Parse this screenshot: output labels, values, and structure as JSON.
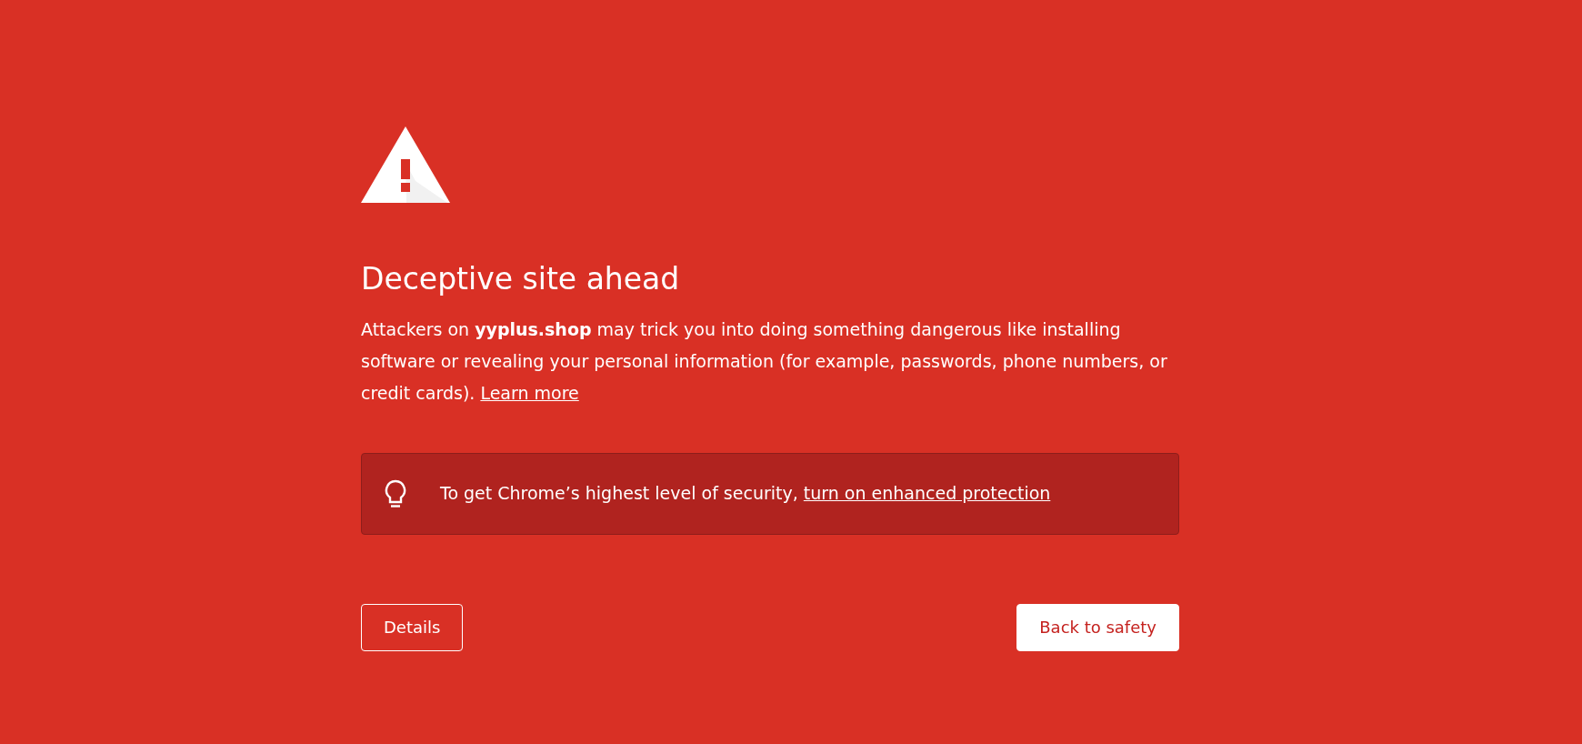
{
  "heading": "Deceptive site ahead",
  "message": "Attackers on **yyplus.shop** may trick you into doing something dangerous like installing software or revealing your personal information (for example, passwords, phone numbers, or credit cards).",
  "learn_more": "Learn more",
  "enhanced": {
    "text": "To get Chrome’s highest level of security,",
    "link": "turn on enhanced protection"
  },
  "buttons": [
    {
      "label": "Details",
      "kind": "secondary"
    },
    {
      "label": "Back to safety",
      "kind": "primary"
    }
  ]
}
